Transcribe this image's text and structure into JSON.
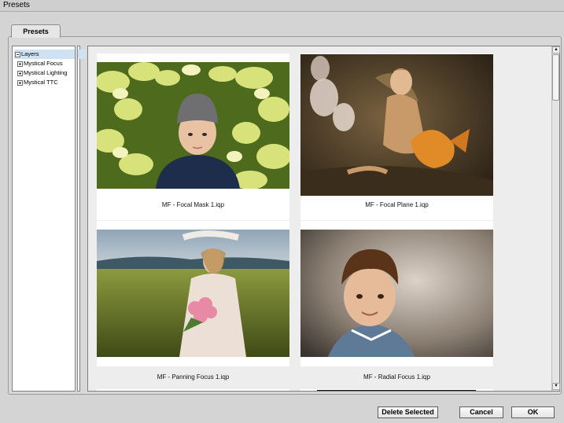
{
  "window": {
    "title": "Presets"
  },
  "tabs": [
    {
      "label": "Presets"
    }
  ],
  "tree": {
    "items": [
      {
        "label": "Layers",
        "expanded": true,
        "selected": true
      },
      {
        "label": "Mystical Focus",
        "expanded": false
      },
      {
        "label": "Mystical Lighting",
        "expanded": false
      },
      {
        "label": "Mystical TTC",
        "expanded": false
      }
    ]
  },
  "presets": [
    {
      "caption": "MF - Focal Mask 1.iqp"
    },
    {
      "caption": "MF - Focal Plane 1.iqp"
    },
    {
      "caption": "MF - Panning Focus 1.iqp"
    },
    {
      "caption": "MF - Radial Focus 1.iqp"
    }
  ],
  "scrollbar": {
    "up": "▲",
    "down": "▼"
  },
  "buttons": {
    "delete_selected": "Delete Selected",
    "cancel": "Cancel",
    "ok": "OK"
  },
  "colors": {
    "selection": "#cfe2f4",
    "dialog_bg": "#d4d4d4"
  }
}
